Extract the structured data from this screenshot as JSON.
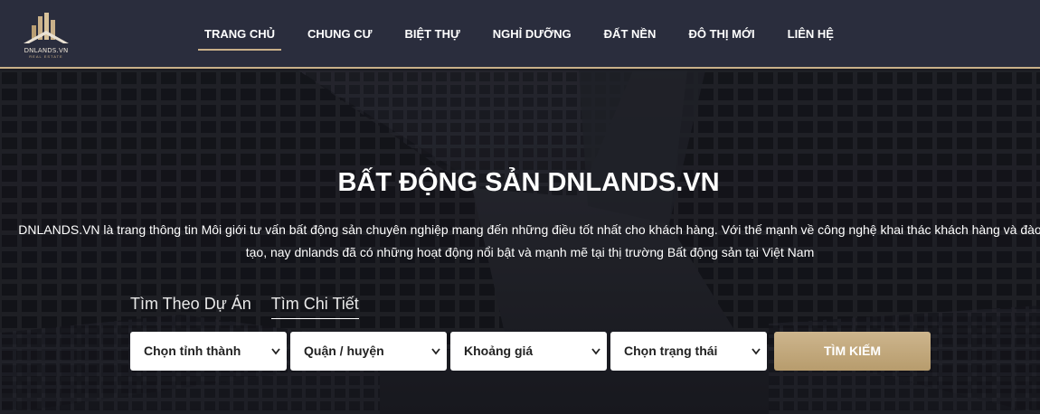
{
  "header": {
    "logo_text": "DNLANDS.VN",
    "logo_sub": "REAL ESTATE",
    "nav": [
      {
        "label": "TRANG CHỦ",
        "active": true
      },
      {
        "label": "CHUNG CƯ"
      },
      {
        "label": "BIỆT THỰ"
      },
      {
        "label": "NGHỈ DƯỠNG"
      },
      {
        "label": "ĐẤT NỀN"
      },
      {
        "label": "ĐÔ THỊ MỚI"
      },
      {
        "label": "LIÊN HỆ"
      }
    ]
  },
  "hero": {
    "title": "BẤT ĐỘNG SẢN DNLANDS.VN",
    "description": "DNLANDS.VN là trang thông tin Môi giới tư vấn bất động sản chuyên nghiệp mang đến những điều tốt nhất cho khách hàng. Với thế mạnh về công nghệ khai thác khách hàng và đào tạo, nay dnlands đã có những hoạt động nổi bật và mạnh mẽ tại thị trường Bất động sản tại Việt Nam"
  },
  "search": {
    "tabs": [
      {
        "label": "Tìm Theo Dự Án"
      },
      {
        "label": "Tìm Chi Tiết",
        "active": true
      }
    ],
    "province": "Chọn tỉnh thành",
    "district": "Quận / huyện",
    "price": "Khoảng giá",
    "status": "Chọn trạng thái",
    "button": "TÌM KIẾM"
  },
  "colors": {
    "header_bg": "#2a2d3d",
    "accent_gold": "#c9b089",
    "button_gold": "#c2a87b"
  }
}
